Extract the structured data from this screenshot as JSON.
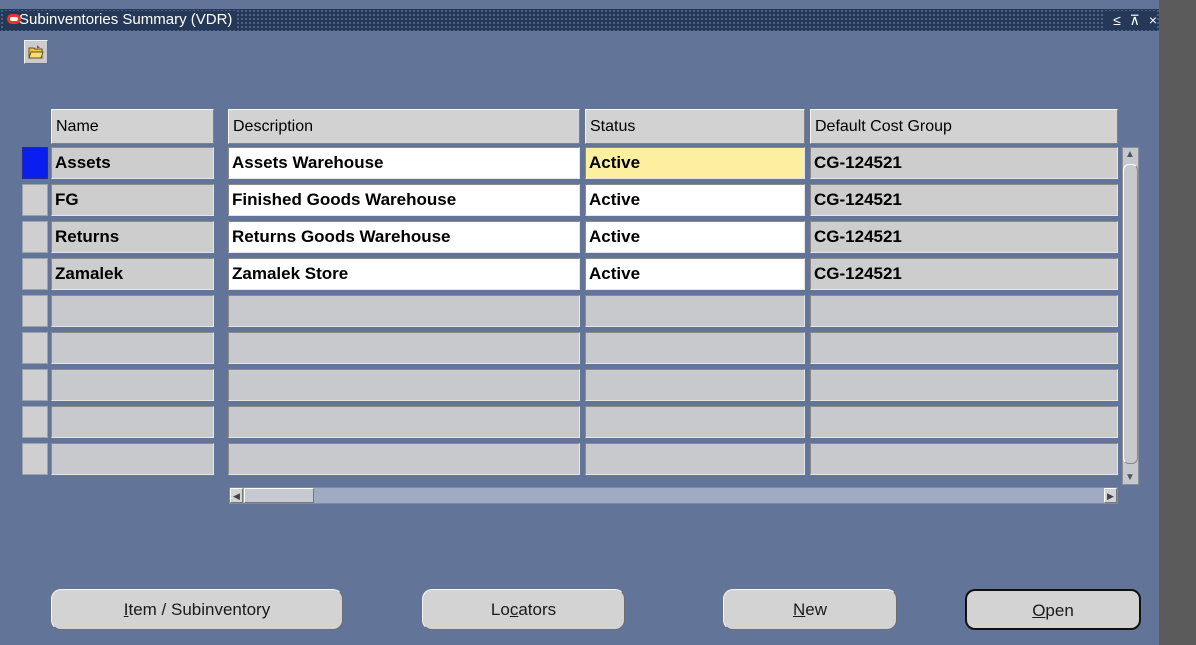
{
  "window": {
    "title": "Subinventories Summary (VDR)",
    "controls": [
      "≤",
      "⊼",
      "×"
    ]
  },
  "toolbar": {
    "open_folder_icon": "folder-open-icon"
  },
  "table": {
    "headers": [
      "Name",
      "Description",
      "Status",
      "Default Cost Group"
    ],
    "rows": [
      {
        "name": "Assets",
        "description": "Assets Warehouse",
        "status": "Active",
        "cost_group": "CG-124521"
      },
      {
        "name": "FG",
        "description": "Finished Goods Warehouse",
        "status": "Active",
        "cost_group": "CG-124521"
      },
      {
        "name": "Returns",
        "description": "Returns Goods Warehouse",
        "status": "Active",
        "cost_group": "CG-124521"
      },
      {
        "name": "Zamalek",
        "description": "Zamalek Store",
        "status": "Active",
        "cost_group": "CG-124521"
      }
    ],
    "empty_rows": 5,
    "current_row": 1
  },
  "buttons": {
    "item_subinventory": {
      "prefix": "",
      "mnemonic": "I",
      "suffix": "tem / Subinventory"
    },
    "locators": {
      "prefix": "Lo",
      "mnemonic": "c",
      "suffix": "ators"
    },
    "new": {
      "prefix": "",
      "mnemonic": "N",
      "suffix": "ew"
    },
    "open": {
      "prefix": "",
      "mnemonic": "O",
      "suffix": "pen"
    }
  },
  "colors": {
    "window_bg": "#637499",
    "title_bar": "#253858",
    "current_record": "#0a1ef0",
    "focused_cell": "#fcf0a0"
  }
}
